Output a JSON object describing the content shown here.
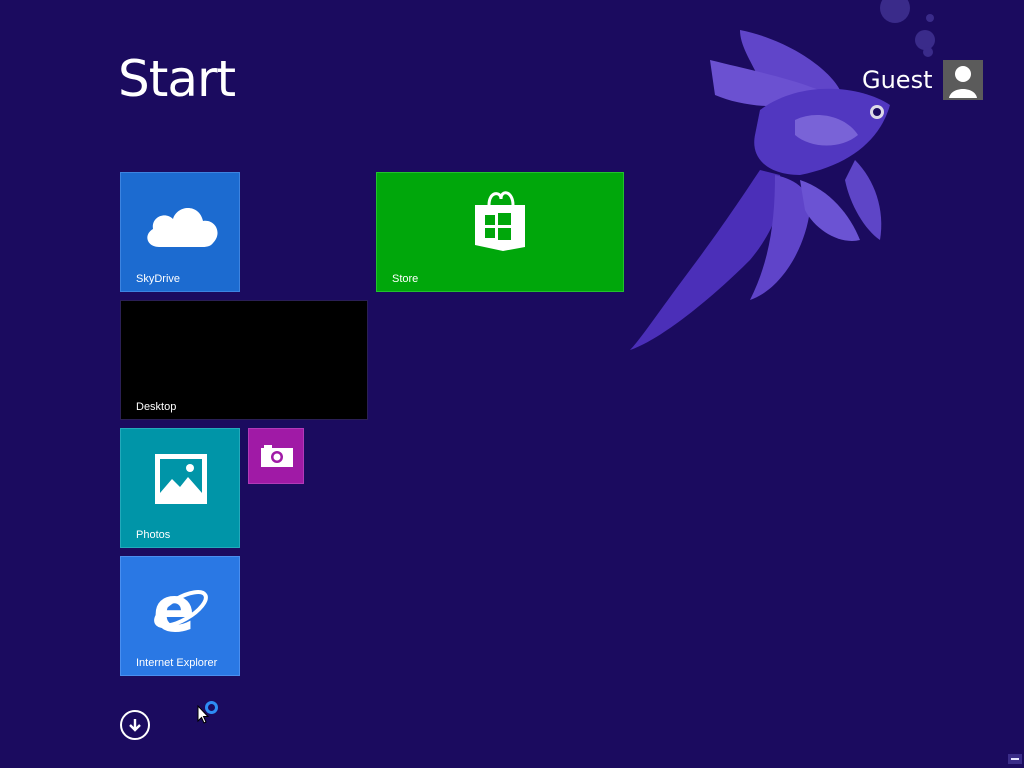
{
  "header": {
    "title": "Start",
    "user_name": "Guest"
  },
  "tiles": [
    {
      "label": "SkyDrive",
      "icon": "cloud-icon",
      "color": "#1c6bd0"
    },
    {
      "label": "Store",
      "icon": "store-bag-icon",
      "color": "#00a70b"
    },
    {
      "label": "Desktop",
      "icon": "",
      "color": "#000000"
    },
    {
      "label": "Photos",
      "icon": "photo-icon",
      "color": "#0095a8"
    },
    {
      "label": "",
      "icon": "camera-icon",
      "color": "#a01aa6"
    },
    {
      "label": "Internet Explorer",
      "icon": "internet-explorer-icon",
      "color": "#2a78e4"
    }
  ],
  "colors": {
    "background": "#1b0b5f",
    "accent_busy": "#2e8df5"
  },
  "footer": {
    "all_apps_icon": "arrow-down-circle-icon"
  }
}
